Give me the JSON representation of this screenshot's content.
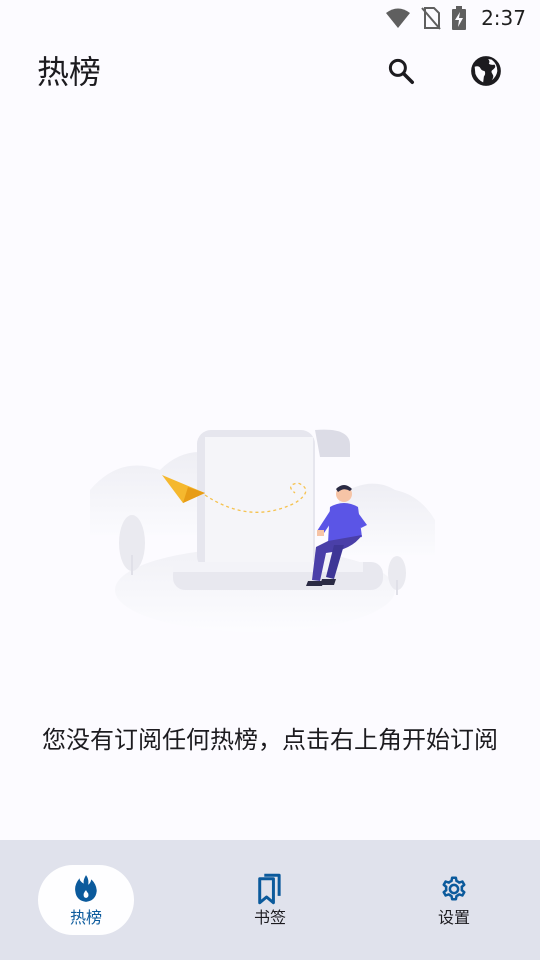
{
  "status_bar": {
    "time": "2:37",
    "icons": [
      "wifi-icon",
      "no-sim-icon",
      "battery-charging-icon"
    ]
  },
  "app_bar": {
    "title": "热榜",
    "actions": [
      {
        "icon": "search-icon"
      },
      {
        "icon": "globe-icon"
      }
    ]
  },
  "empty_state": {
    "illustration": "person-sitting-on-scroll-with-paper-plane",
    "message": "您没有订阅任何热榜，点击右上角开始订阅"
  },
  "bottom_nav": {
    "items": [
      {
        "label": "热榜",
        "icon": "flame-icon",
        "active": true
      },
      {
        "label": "书签",
        "icon": "bookmarks-icon",
        "active": false
      },
      {
        "label": "设置",
        "icon": "gear-icon",
        "active": false
      }
    ]
  },
  "colors": {
    "background": "#fcfbff",
    "nav_background": "#e0e2ec",
    "accent": "#0b5a9c",
    "illustration_person": "#5b55e6",
    "paper_plane": "#f5b82e"
  }
}
